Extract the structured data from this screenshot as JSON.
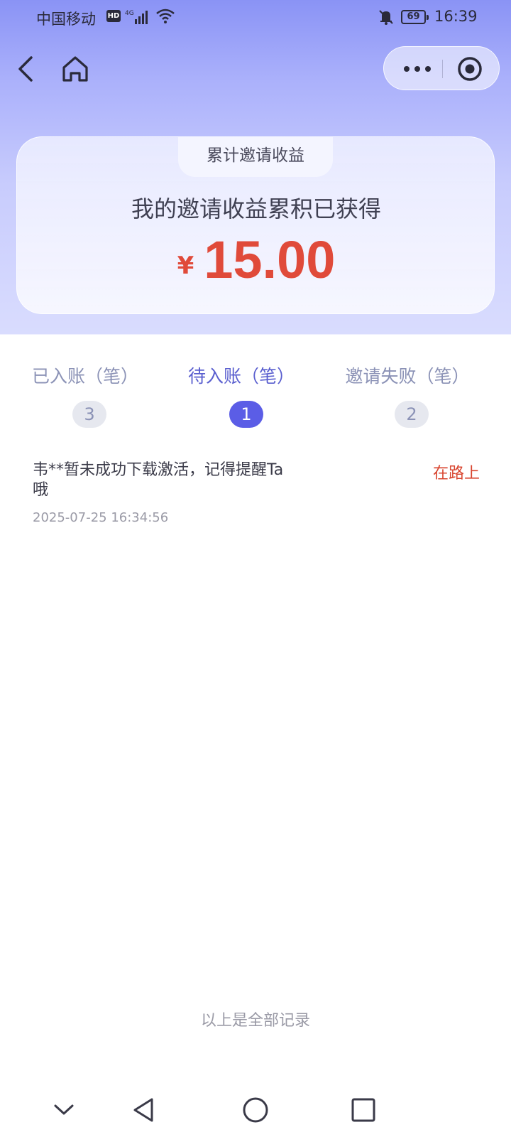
{
  "status_bar": {
    "carrier": "中国移动",
    "hd": "HD",
    "battery": "69",
    "time": "16:39",
    "icons": [
      "signal-icon",
      "wifi-icon",
      "mute-icon",
      "battery-icon"
    ]
  },
  "nav": {
    "back_icon": "chevron-left-icon",
    "home_icon": "home-icon",
    "more_icon": "more-dots-icon",
    "close_icon": "target-icon"
  },
  "card": {
    "tab_label": "累计邀请收益",
    "subtitle": "我的邀请收益累积已获得",
    "currency": "¥",
    "amount": "15.00"
  },
  "tabs": [
    {
      "label": "已入账（笔）",
      "count": "3",
      "active": false
    },
    {
      "label": "待入账（笔）",
      "count": "1",
      "active": true
    },
    {
      "label": "邀请失败（笔）",
      "count": "2",
      "active": false
    }
  ],
  "records": [
    {
      "text": "韦**暂未成功下载激活，记得提醒Ta哦",
      "status": "在路上",
      "time": "2025-07-25 16:34:56"
    }
  ],
  "footer_note": "以上是全部记录",
  "colors": {
    "accent": "#5b5de6",
    "amount": "#e04a3a",
    "status": "#d8452f"
  }
}
